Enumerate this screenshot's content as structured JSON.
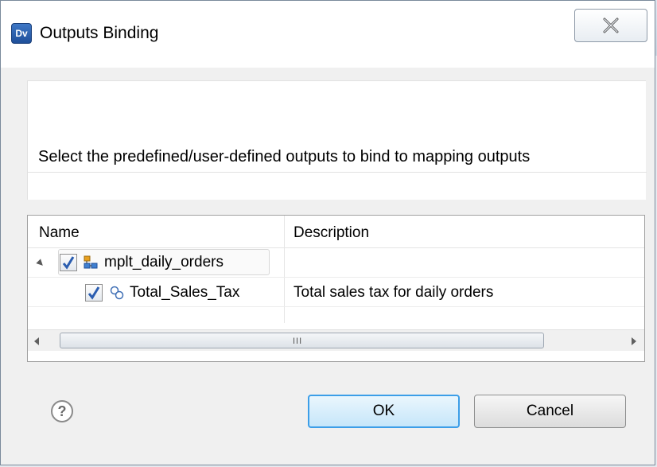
{
  "window": {
    "app_icon_text": "Dv",
    "title": "Outputs Binding",
    "close_icon": "close-icon"
  },
  "message": "Select the predefined/user-defined outputs to bind to mapping outputs",
  "table": {
    "columns": [
      "Name",
      "Description"
    ],
    "rows": [
      {
        "name": "mplt_daily_orders",
        "description": "",
        "checked": true,
        "expanded": true,
        "level": 0,
        "icon": "mapplet-icon"
      },
      {
        "name": "Total_Sales_Tax",
        "description": "Total sales tax for daily orders",
        "checked": true,
        "level": 1,
        "icon": "output-icon"
      }
    ],
    "scrollbar_grip": "III"
  },
  "footer": {
    "help_label": "?",
    "ok_label": "OK",
    "cancel_label": "Cancel"
  }
}
